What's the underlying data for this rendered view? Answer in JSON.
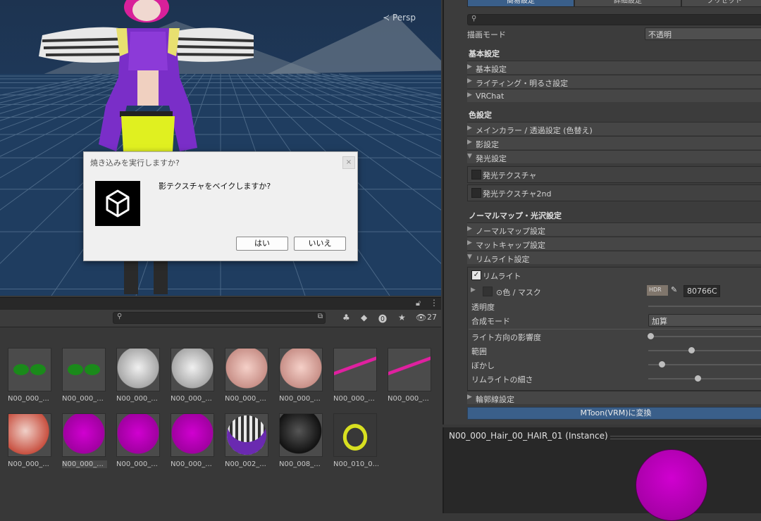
{
  "scene": {
    "camera_label": "≺ Persp"
  },
  "dialog": {
    "title": "焼き込みを実行しますか?",
    "message": "影テクスチャをベイクしますか?",
    "yes_label": "はい",
    "no_label": "いいえ",
    "close_glyph": "×"
  },
  "project": {
    "hidden_count": "27",
    "assets": [
      {
        "label": "N00_000_...",
        "kind": "leaf"
      },
      {
        "label": "N00_000_...",
        "kind": "leaf"
      },
      {
        "label": "N00_000_...",
        "kind": "white"
      },
      {
        "label": "N00_000_...",
        "kind": "white"
      },
      {
        "label": "N00_000_...",
        "kind": "skin"
      },
      {
        "label": "N00_000_...",
        "kind": "skin"
      },
      {
        "label": "N00_000_...",
        "kind": "brows"
      },
      {
        "label": "N00_000_...",
        "kind": "brows"
      },
      {
        "label": "N00_000_...",
        "kind": "red"
      },
      {
        "label": "N00_000_...",
        "kind": "magenta",
        "selected": true
      },
      {
        "label": "N00_000_...",
        "kind": "magenta"
      },
      {
        "label": "N00_000_...",
        "kind": "magenta"
      },
      {
        "label": "N00_002_...",
        "kind": "stripes"
      },
      {
        "label": "N00_008_...",
        "kind": "black"
      },
      {
        "label": "N00_010_0...",
        "kind": "ring"
      }
    ]
  },
  "inspector": {
    "tabs": [
      "簡易設定",
      "詳細設定",
      "プリセット"
    ],
    "render_mode_label": "描画モード",
    "render_mode_value": "不透明",
    "basic_header": "基本設定",
    "basic_items": [
      "基本設定",
      "ライティング・明るさ設定",
      "VRChat"
    ],
    "color_header": "色設定",
    "color_items": [
      "メインカラー / 透過設定 (色替え)",
      "影設定",
      "発光設定"
    ],
    "emission_tex": "発光テクスチャ",
    "emission_tex2": "発光テクスチャ2nd",
    "normal_header": "ノーマルマップ・光沢設定",
    "normal_items": [
      "ノーマルマップ設定",
      "マットキャップ設定",
      "リムライト設定"
    ],
    "rimlight_label": "リムライト",
    "rim_color_label": "⊙色 / マスク",
    "hdr_label": "HDR",
    "rim_color_hex": "80766C",
    "transparency_label": "透明度",
    "blend_mode_label": "合成モード",
    "blend_mode_value": "加算",
    "light_dir_label": "ライト方向の影響度",
    "range_label": "範囲",
    "blur_label": "ぼかし",
    "rim_width_label": "リムライトの細さ",
    "outline_label": "輪郭線設定",
    "convert_label": "MToon(VRM)に変換",
    "sliders": {
      "light_dir": 0.02,
      "range": 0.36,
      "blur": 0.11,
      "rim_width": 0.41
    }
  },
  "preview": {
    "title": "N00_000_Hair_00_HAIR_01 (Instance)"
  }
}
